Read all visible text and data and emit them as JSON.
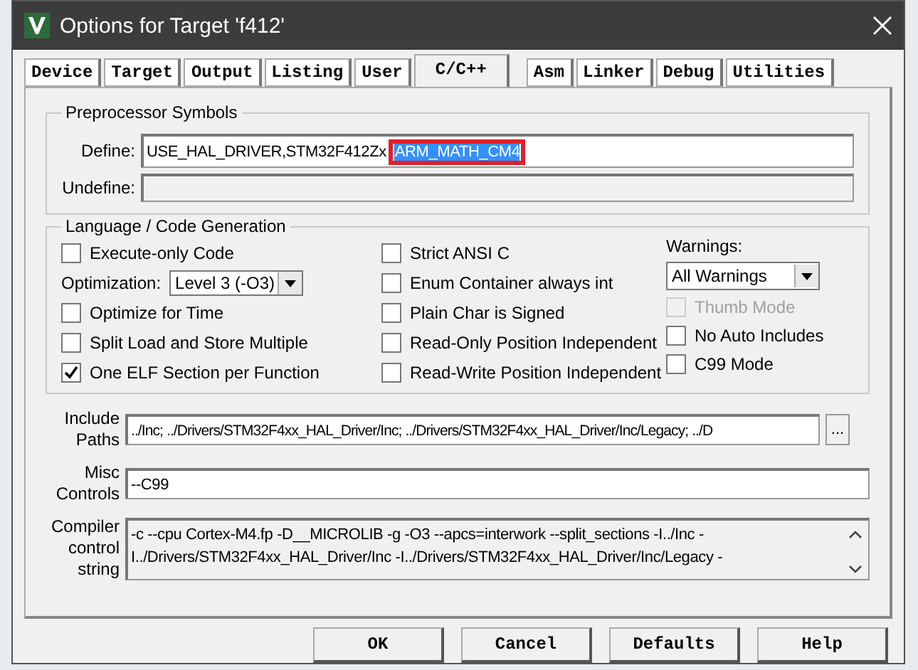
{
  "window": {
    "title": "Options for Target 'f412'"
  },
  "tabs": [
    {
      "label": "Device",
      "selected": false
    },
    {
      "label": "Target",
      "selected": false
    },
    {
      "label": "Output",
      "selected": false
    },
    {
      "label": "Listing",
      "selected": false
    },
    {
      "label": "User",
      "selected": false
    },
    {
      "label": "C/C++",
      "selected": true
    },
    {
      "label": "Asm",
      "selected": false
    },
    {
      "label": "Linker",
      "selected": false
    },
    {
      "label": "Debug",
      "selected": false
    },
    {
      "label": "Utilities",
      "selected": false
    }
  ],
  "preprocessor": {
    "title": "Preprocessor Symbols",
    "define_label": "Define:",
    "define_value": "USE_HAL_DRIVER,STM32F412Zx",
    "define_selected": "ARM_MATH_CM4",
    "define_highlighted": true,
    "undefine_label": "Undefine:"
  },
  "language": {
    "title": "Language / Code Generation",
    "column_1": [
      {
        "kind": "checkbox",
        "label": "Execute-only Code",
        "checked": false,
        "disabled": false
      },
      {
        "kind": "dropdown",
        "label": "Optimization:",
        "value": "Level 3 (-O3)"
      },
      {
        "kind": "checkbox",
        "label": "Optimize for Time",
        "checked": false,
        "disabled": false
      },
      {
        "kind": "checkbox",
        "label": "Split Load and Store Multiple",
        "checked": false,
        "disabled": false
      },
      {
        "kind": "checkbox",
        "label": "One ELF Section per Function",
        "checked": true,
        "disabled": false
      }
    ],
    "column_2": [
      {
        "kind": "checkbox",
        "label": "Strict ANSI C",
        "checked": false,
        "disabled": false
      },
      {
        "kind": "checkbox",
        "label": "Enum Container always int",
        "checked": false,
        "disabled": false
      },
      {
        "kind": "checkbox",
        "label": "Plain Char is Signed",
        "checked": false,
        "disabled": false
      },
      {
        "kind": "checkbox",
        "label": "Read-Only Position Independent",
        "checked": false,
        "disabled": false
      },
      {
        "kind": "checkbox",
        "label": "Read-Write Position Independent",
        "checked": false,
        "disabled": false
      }
    ],
    "warnings_label": "Warnings:",
    "warnings_value": "All Warnings",
    "column_3": [
      {
        "kind": "checkbox",
        "label": "Thumb Mode",
        "checked": false,
        "disabled": true
      },
      {
        "kind": "checkbox",
        "label": "No Auto Includes",
        "checked": false,
        "disabled": false
      },
      {
        "kind": "checkbox",
        "label": "C99 Mode",
        "checked": false,
        "disabled": false
      }
    ]
  },
  "include_paths": {
    "label": [
      "Include",
      "Paths"
    ],
    "value": "../Inc; ../Drivers/STM32F4xx_HAL_Driver/Inc; ../Drivers/STM32F4xx_HAL_Driver/Inc/Legacy; ../D",
    "browse": "..."
  },
  "misc_controls": {
    "label": [
      "Misc",
      "Controls"
    ],
    "value": "--C99"
  },
  "compiler_string": {
    "label": [
      "Compiler",
      "control",
      "string"
    ],
    "lines": [
      "-c --cpu Cortex-M4.fp -D__MICROLIB -g -O3 --apcs=interwork --split_sections -I../Inc -",
      "I../Drivers/STM32F4xx_HAL_Driver/Inc -I../Drivers/STM32F4xx_HAL_Driver/Inc/Legacy -"
    ]
  },
  "buttons": [
    "OK",
    "Cancel",
    "Defaults",
    "Help"
  ]
}
